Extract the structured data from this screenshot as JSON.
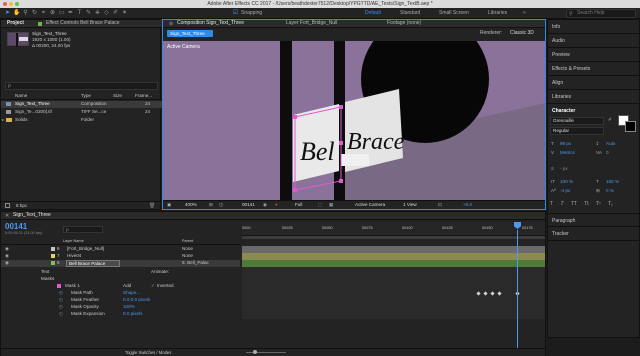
{
  "window": {
    "title": "Adobe After Effects CC 2017 - /Users/beathdexter7512/Desktop/YPGTTD/AE_Tests/Sign_TextB.aep *"
  },
  "workspaces": {
    "snapping": "Snapping",
    "default": "Default",
    "standard": "Standard",
    "small_screen": "Small Screen",
    "libraries": "Libraries",
    "search_placeholder": "Search Help"
  },
  "project_panel": {
    "tab": "Project",
    "effect_controls_tab": "Effect Controls Bell Brace Palace",
    "thumb_name": "Sign_Text_Three",
    "thumb_info1": "1920 x 1080 (1.00)",
    "thumb_info2": "Δ 00200, 24.00 fps",
    "search_placeholder": "ρ",
    "columns": {
      "name": "Name",
      "type": "Type",
      "size": "Size",
      "frame": "Frame..."
    },
    "items": [
      {
        "name": "Sign_Text_Three",
        "type": "Composition",
        "size": "",
        "frame": "24"
      },
      {
        "name": "Sign_Te...0200].tif",
        "type": "TIFF Se...ce",
        "size": "",
        "frame": "24"
      },
      {
        "name": "Solids",
        "type": "Folder",
        "size": "",
        "frame": ""
      }
    ],
    "bpc": "8 bpc"
  },
  "comp_panel": {
    "comp_tab": "Composition Sign_Text_Three",
    "layer_tab": "Layer Fort_Bridge_Null",
    "footage_tab": "Footage (none)",
    "comp_name_tab": "Sign_Text_Three",
    "renderer_label": "Renderer:",
    "renderer_value": "Classic 3D",
    "active_camera": "Active Camera",
    "sign_text_left": "Bel",
    "sign_text_right": "Brace",
    "bottom": {
      "zoom": "400%",
      "timecode": "00141",
      "resolution": "Full",
      "camera": "Active Camera",
      "view": "1 View",
      "exposure": "+0.0"
    }
  },
  "right_panels": {
    "items": [
      "Info",
      "Audio",
      "Preview",
      "Effects & Presets",
      "Align",
      "Libraries"
    ],
    "character": {
      "title": "Character",
      "font": "Grenouille",
      "style": "Regular",
      "size": "98 px",
      "leading": "Auto",
      "kerning": "Metrics",
      "tracking": "0",
      "stroke_width": "- px",
      "vscale": "100 %",
      "hscale": "100 %",
      "baseline": "-4 px",
      "tsume": "0 %"
    },
    "paragraph": "Paragraph",
    "tracker": "Tracker"
  },
  "timeline": {
    "tab": "Sign_Text_Three",
    "timecode": "00141",
    "timecode_sub": "0:00:05:21 (24.00 fps)",
    "search_placeholder": "ρ",
    "header_layer": "Layer Name",
    "header_parent": "Parent",
    "layers": [
      {
        "num": "6",
        "name": "[Fort_Bridge_Null]",
        "parent": "None"
      },
      {
        "num": "7",
        "name": "Hive04",
        "parent": "None"
      },
      {
        "num": "8",
        "name": "Bell Brace Palace",
        "parent": "9. Bell_Palac"
      }
    ],
    "animate_label": "Animate:",
    "text_label": "Text",
    "masks_label": "Masks",
    "mask1": {
      "name": "Mask 1",
      "mode": "Add",
      "inverted": "Inverted",
      "path_label": "Mask Path",
      "path_value": "Shape...",
      "feather_label": "Mask Feather",
      "feather_value": "0.0,0.0 pixels",
      "opacity_label": "Mask Opacity",
      "opacity_value": "100%",
      "expansion_label": "Mask Expansion",
      "expansion_value": "0.0 pixels"
    },
    "toggle_label": "Toggle Switches / Modes",
    "ruler": [
      "0000",
      "00025",
      "00050",
      "00075",
      "00100",
      "00125",
      "00150",
      "00175",
      "0020"
    ]
  },
  "colors": {
    "accent": "#2d8ceb",
    "comp_bg": "#8a729b",
    "layer_green": "#4e7a3a",
    "layer_pink": "#e05bd0"
  }
}
